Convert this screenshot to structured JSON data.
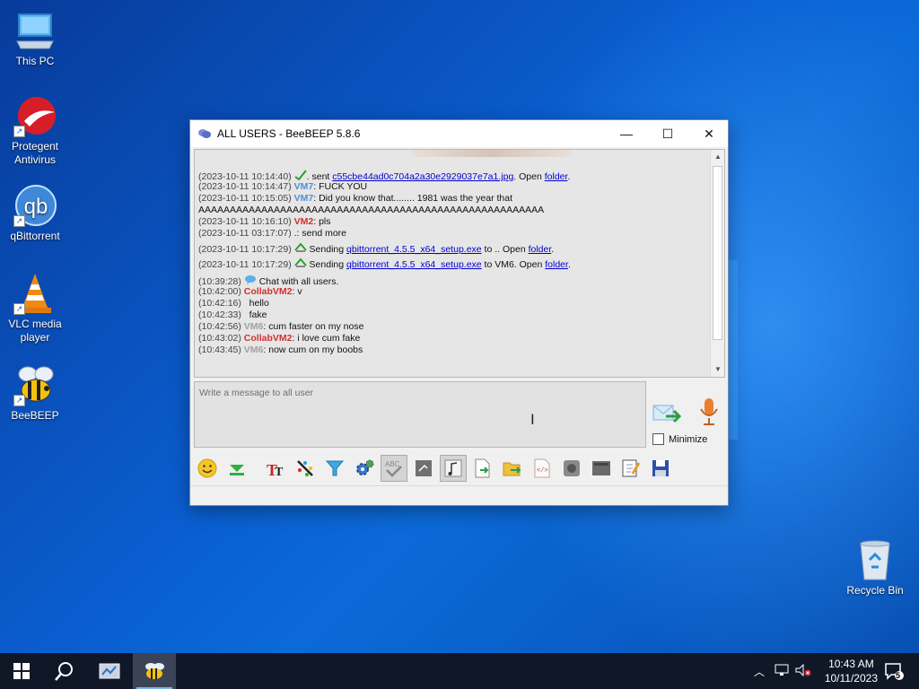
{
  "desktop": {
    "icons": [
      {
        "label": "This PC"
      },
      {
        "label": "Protegent Antivirus"
      },
      {
        "label": "qBittorrent"
      },
      {
        "label": "VLC media player"
      },
      {
        "label": "BeeBEEP"
      },
      {
        "label": "Recycle Bin"
      }
    ]
  },
  "window": {
    "title": "ALL USERS - BeeBEEP 5.8.6",
    "minimize_glyph": "—",
    "maximize_glyph": "☐",
    "close_glyph": "✕"
  },
  "chat": {
    "lines": [
      {
        "ts": "(2023-10-11 10:14:40)",
        "pre": ". sent ",
        "link": "c55cbe44ad0c704a2a30e2929037e7a1.jpg",
        "post": ". Open ",
        "link2": "folder",
        "end": "."
      },
      {
        "ts": "(2023-10-11 10:14:47)",
        "user": "VM7",
        "text": ": FUCK YOU"
      },
      {
        "ts": "(2023-10-11 10:15:05)",
        "user": "VM7",
        "text": ": Did you know that........ 1981 was the year that"
      },
      {
        "text": "AAAAAAAAAAAAAAAAAAAAAAAAAAAAAAAAAAAAAAAAAAAAAAAAAAAAAAA"
      },
      {
        "ts": "(2023-10-11 10:16:10)",
        "user": "VM2",
        "text": ": pls"
      },
      {
        "ts": "(2023-10-11 03:17:07)",
        "text": " .: send more"
      },
      {
        "ts": "(2023-10-11 10:17:29)",
        "pre": " Sending ",
        "link": "qbittorrent_4.5.5_x64_setup.exe",
        "post": " to .. Open ",
        "link2": "folder",
        "end": "."
      },
      {
        "ts": "(2023-10-11 10:17:29)",
        "pre": " Sending ",
        "link": "qbittorrent_4.5.5_x64_setup.exe",
        "post": " to VM6. Open ",
        "link2": "folder",
        "end": "."
      },
      {
        "ts": "(10:39:28)",
        "text": " Chat with all users."
      },
      {
        "ts": "(10:42:00)",
        "user": "CollabVM2",
        "text": ": v"
      },
      {
        "ts": "(10:42:16)",
        "text": "   hello"
      },
      {
        "ts": "(10:42:33)",
        "text": "   fake"
      },
      {
        "ts": "(10:42:56)",
        "user": "VM6",
        "text": ": cum faster on my nose"
      },
      {
        "ts": "(10:43:02)",
        "user": "CollabVM2",
        "text": ": i love cum fake"
      },
      {
        "ts": "(10:43:45)",
        "user": "VM6",
        "text": ": now cum on my boobs"
      }
    ]
  },
  "input": {
    "placeholder": "Write a message to all user"
  },
  "minimize_label": "Minimize",
  "toolbar": {
    "buttons": [
      "emoticons-icon",
      "download-icon",
      "font-icon",
      "color-icon",
      "filter-icon",
      "settings-icon",
      "spellcheck-icon",
      "notes-icon",
      "music-icon",
      "send-file-icon",
      "send-folder-icon",
      "html-icon",
      "record-icon",
      "screenshot-icon",
      "edit-icon",
      "save-icon"
    ]
  },
  "taskbar": {
    "time": "10:43 AM",
    "date": "10/11/2023",
    "notification_count": "5"
  },
  "colors": {
    "vm7": "#4e8ed8",
    "vm2": "#d23030",
    "vm6": "#a0a0a0",
    "link": "#0000d0"
  }
}
